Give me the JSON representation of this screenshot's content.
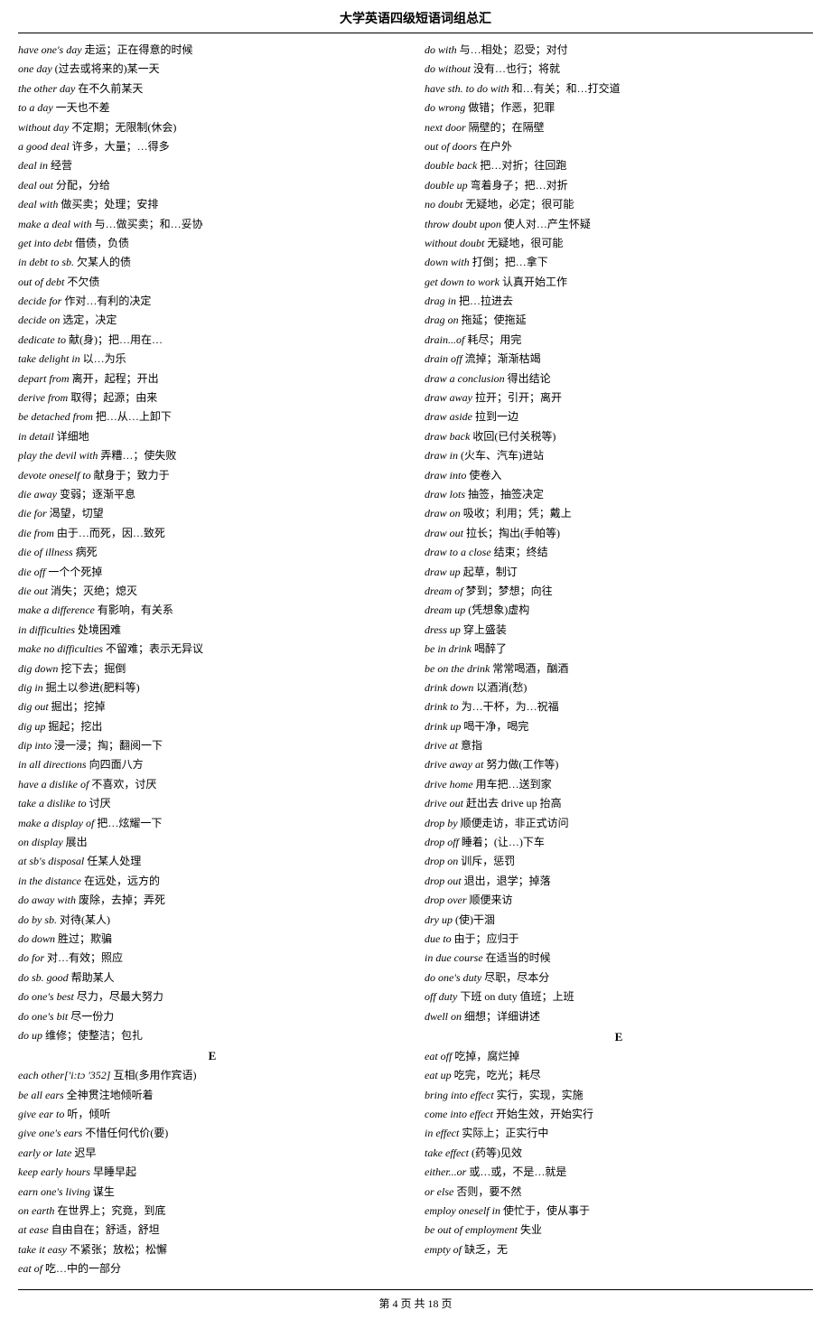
{
  "header": {
    "title": "大学英语四级短语词组总汇"
  },
  "footer": {
    "text": "第 4 页 共 18 页"
  },
  "left_col": [
    {
      "en": "have one's day",
      "zh": "走运；正在得意的时候"
    },
    {
      "en": "one day",
      "zh": "(过去或将来的)某一天"
    },
    {
      "en": "the other day",
      "zh": "在不久前某天"
    },
    {
      "en": "to a day",
      "zh": "一天也不差"
    },
    {
      "en": "without day",
      "zh": "不定期；无限制(休会)"
    },
    {
      "en": "a good deal",
      "zh": "许多，大量；…得多"
    },
    {
      "en": "deal in",
      "zh": "经营"
    },
    {
      "en": "deal out",
      "zh": "分配，分给"
    },
    {
      "en": "deal with",
      "zh": "做买卖；处理；安排"
    },
    {
      "en": "make a deal with",
      "zh": "与…做买卖；和…妥协"
    },
    {
      "en": "get into debt",
      "zh": "借债，负债"
    },
    {
      "en": "in debt to sb.",
      "zh": "欠某人的债"
    },
    {
      "en": "out of debt",
      "zh": "不欠债"
    },
    {
      "en": "decide for",
      "zh": "作对…有利的决定"
    },
    {
      "en": "decide on",
      "zh": "选定，决定"
    },
    {
      "en": "dedicate to",
      "zh": "献(身)；把…用在…"
    },
    {
      "en": "take delight in",
      "zh": "以…为乐"
    },
    {
      "en": "depart from",
      "zh": "离开，起程；开出"
    },
    {
      "en": "derive from",
      "zh": "取得；起源；由来"
    },
    {
      "en": "be detached from",
      "zh": "把…从…上卸下"
    },
    {
      "en": "in detail",
      "zh": "详细地"
    },
    {
      "en": "play the devil with",
      "zh": "弄糟…；使失败"
    },
    {
      "en": "devote oneself to",
      "zh": "献身于；致力于"
    },
    {
      "en": "die away",
      "zh": "变弱；逐渐平息"
    },
    {
      "en": "die for",
      "zh": "渴望，切望"
    },
    {
      "en": "die from",
      "zh": "由于…而死，因…致死"
    },
    {
      "en": "die of illness",
      "zh": "病死"
    },
    {
      "en": "die off",
      "zh": "一个个死掉"
    },
    {
      "en": "die out",
      "zh": "消失；灭绝；熄灭"
    },
    {
      "en": "make a difference",
      "zh": "有影响，有关系"
    },
    {
      "en": "in difficulties",
      "zh": "处境困难"
    },
    {
      "en": "make no difficulties",
      "zh": "不留难；表示无异议"
    },
    {
      "en": "dig down",
      "zh": "挖下去；掘倒"
    },
    {
      "en": "dig in",
      "zh": "掘土以参进(肥料等)"
    },
    {
      "en": "dig out",
      "zh": "掘出；挖掉"
    },
    {
      "en": "dig up",
      "zh": "掘起；挖出"
    },
    {
      "en": "dip into",
      "zh": "浸一浸；掏；翻阅一下"
    },
    {
      "en": "in all directions",
      "zh": "向四面八方"
    },
    {
      "en": "have a dislike of",
      "zh": "不喜欢，讨厌"
    },
    {
      "en": "take a dislike to",
      "zh": "讨厌"
    },
    {
      "en": "make a display of",
      "zh": "把…炫耀一下"
    },
    {
      "en": "on display",
      "zh": "展出"
    },
    {
      "en": "at sb's disposal",
      "zh": "任某人处理"
    },
    {
      "en": "in the distance",
      "zh": "在远处，远方的"
    },
    {
      "en": "do away with",
      "zh": "废除，去掉；弄死"
    },
    {
      "en": "do by sb.",
      "zh": "对待(某人)"
    },
    {
      "en": "do down",
      "zh": "胜过；欺骗"
    },
    {
      "en": "do for",
      "zh": "对…有效；照应"
    },
    {
      "en": "do sb. good",
      "zh": "帮助某人"
    },
    {
      "en": "do one's best",
      "zh": "尽力，尽最大努力"
    },
    {
      "en": "do one's bit",
      "zh": "尽一份力"
    },
    {
      "en": "do up",
      "zh": "维修；使整洁；包扎"
    },
    {
      "section": "E"
    },
    {
      "en": "each other['i:tɔ '352]",
      "zh": "互相(多用作宾语)"
    },
    {
      "en": "be all ears",
      "zh": "全神贯注地倾听着"
    },
    {
      "en": "give ear to",
      "zh": "听，倾听"
    },
    {
      "en": "give one's ears",
      "zh": "不惜任何代价(要)"
    },
    {
      "en": "early or late",
      "zh": "迟早"
    },
    {
      "en": "keep early hours",
      "zh": "早睡早起"
    },
    {
      "en": "earn one's living",
      "zh": "谋生"
    },
    {
      "en": "on earth",
      "zh": "在世界上；究竟，到底"
    },
    {
      "en": "at ease",
      "zh": "自由自在；舒适，舒坦"
    },
    {
      "en": "take it easy",
      "zh": "不紧张；放松；松懈"
    },
    {
      "en": "eat of",
      "zh": "吃…中的一部分"
    }
  ],
  "right_col": [
    {
      "en": "do with",
      "zh": "与…相处；忍受；对付"
    },
    {
      "en": "do without",
      "zh": "没有…也行；将就"
    },
    {
      "en": "have sth. to do with",
      "zh": "和…有关；和…打交道"
    },
    {
      "en": "do wrong",
      "zh": "做错；作恶，犯罪"
    },
    {
      "en": "next door",
      "zh": "隔壁的；在隔壁"
    },
    {
      "en": "out of doors",
      "zh": "在户外"
    },
    {
      "en": "double back",
      "zh": "把…对折；往回跑"
    },
    {
      "en": "double up",
      "zh": "弯着身子；把…对折"
    },
    {
      "en": "no doubt",
      "zh": "无疑地，必定；很可能"
    },
    {
      "en": "throw doubt upon",
      "zh": "使人对…产生怀疑"
    },
    {
      "en": "without doubt",
      "zh": "无疑地，很可能"
    },
    {
      "en": "down with",
      "zh": "打倒；把…拿下"
    },
    {
      "en": "get down to work",
      "zh": "认真开始工作"
    },
    {
      "en": "drag in",
      "zh": "把…拉进去"
    },
    {
      "en": "drag on",
      "zh": "拖延；使拖延"
    },
    {
      "en": "drain...of",
      "zh": "耗尽；用完"
    },
    {
      "en": "drain off",
      "zh": "流掉；渐渐枯竭"
    },
    {
      "en": "draw a conclusion",
      "zh": "得出结论"
    },
    {
      "en": "draw away",
      "zh": "拉开；引开；离开"
    },
    {
      "en": "draw aside",
      "zh": "拉到一边"
    },
    {
      "en": "draw back",
      "zh": "收回(已付关税等)"
    },
    {
      "en": "draw in",
      "zh": "(火车、汽车)进站"
    },
    {
      "en": "draw into",
      "zh": "使卷入"
    },
    {
      "en": "draw lots",
      "zh": "抽签，抽签决定"
    },
    {
      "en": "draw on",
      "zh": "吸收；利用；凭；戴上"
    },
    {
      "en": "draw out",
      "zh": "拉长；掏出(手帕等)"
    },
    {
      "en": "draw to a close",
      "zh": "结束；终结"
    },
    {
      "en": "draw up",
      "zh": "起草，制订"
    },
    {
      "en": "dream of",
      "zh": "梦到；梦想；向往"
    },
    {
      "en": "dream up",
      "zh": "(凭想象)虚构"
    },
    {
      "en": "dress up",
      "zh": "穿上盛装"
    },
    {
      "en": "be in drink",
      "zh": "喝醉了"
    },
    {
      "en": "be on the drink",
      "zh": "常常喝酒，酗酒"
    },
    {
      "en": "drink down",
      "zh": "以酒消(愁)"
    },
    {
      "en": "drink to",
      "zh": "为…干杯，为…祝福"
    },
    {
      "en": "drink up",
      "zh": "喝干净，喝完"
    },
    {
      "en": "drive at",
      "zh": "意指"
    },
    {
      "en": "drive away at",
      "zh": "努力做(工作等)"
    },
    {
      "en": "drive home",
      "zh": "用车把…送到家"
    },
    {
      "en": "drive out",
      "zh": "赶出去    drive up 抬高"
    },
    {
      "en": "drop by",
      "zh": "顺便走访，非正式访问"
    },
    {
      "en": "drop off",
      "zh": "睡着；(让…)下车"
    },
    {
      "en": "drop on",
      "zh": "训斥，惩罚"
    },
    {
      "en": "drop out",
      "zh": "退出，退学；掉落"
    },
    {
      "en": "drop over",
      "zh": "顺便来访"
    },
    {
      "en": "dry up",
      "zh": "(使)干涸"
    },
    {
      "en": "due to",
      "zh": "由于；应归于"
    },
    {
      "en": "in due course",
      "zh": "在适当的时候"
    },
    {
      "en": "do one's duty",
      "zh": "尽职，尽本分"
    },
    {
      "en": "off duty",
      "zh": "下班    on duty 值班；上班"
    },
    {
      "en": "dwell on",
      "zh": "细想；详细讲述"
    },
    {
      "section_right": "E"
    },
    {
      "en": "eat off",
      "zh": "吃掉，腐烂掉"
    },
    {
      "en": "eat up",
      "zh": "吃完，吃光；耗尽"
    },
    {
      "en": "bring into effect",
      "zh": "实行，实现，实施"
    },
    {
      "en": "come into effect",
      "zh": "开始生效，开始实行"
    },
    {
      "en": "in effect",
      "zh": "实际上；正实行中"
    },
    {
      "en": "take effect",
      "zh": "(药等)见效"
    },
    {
      "en": "either...or",
      "zh": "或…或，不是…就是"
    },
    {
      "en": "or else",
      "zh": "否则，要不然"
    },
    {
      "en": "employ oneself in",
      "zh": "使忙于，使从事于"
    },
    {
      "en": "be out of employment",
      "zh": "失业"
    },
    {
      "en": "empty of",
      "zh": "缺乏，无"
    }
  ]
}
